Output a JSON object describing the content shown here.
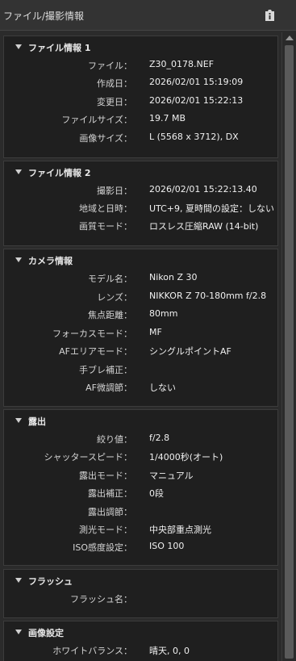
{
  "titlebar": {
    "title": "ファイル/撮影情報",
    "info_icon": "info-icon"
  },
  "sections": [
    {
      "title": "ファイル情報 1",
      "rows": [
        {
          "label": "ファイル：",
          "value": "Z30_0178.NEF"
        },
        {
          "label": "作成日：",
          "value": "2026/02/01 15:19:09"
        },
        {
          "label": "変更日：",
          "value": "2026/02/01 15:22:13"
        },
        {
          "label": "ファイルサイズ：",
          "value": "19.7 MB"
        },
        {
          "label": "画像サイズ：",
          "value": "L (5568 x 3712), DX"
        }
      ]
    },
    {
      "title": "ファイル情報 2",
      "rows": [
        {
          "label": "撮影日：",
          "value": "2026/02/01 15:22:13.40"
        },
        {
          "label": "地域と日時：",
          "value": "UTC+9, 夏時間の設定：しない"
        },
        {
          "label": "画質モード：",
          "value": "ロスレス圧縮RAW (14-bit)"
        }
      ]
    },
    {
      "title": "カメラ情報",
      "rows": [
        {
          "label": "モデル名：",
          "value": "Nikon Z 30"
        },
        {
          "label": "レンズ：",
          "value": "NIKKOR Z 70-180mm f/2.8"
        },
        {
          "label": "焦点距離：",
          "value": "80mm"
        },
        {
          "label": "フォーカスモード：",
          "value": "MF"
        },
        {
          "label": "AFエリアモード：",
          "value": "シングルポイントAF"
        },
        {
          "label": "手ブレ補正：",
          "value": ""
        },
        {
          "label": "AF微調節：",
          "value": "しない"
        }
      ]
    },
    {
      "title": "露出",
      "rows": [
        {
          "label": "絞り値：",
          "value": "f/2.8"
        },
        {
          "label": "シャッタースピード：",
          "value": "1/4000秒(オート)"
        },
        {
          "label": "露出モード：",
          "value": "マニュアル"
        },
        {
          "label": "露出補正：",
          "value": "0段"
        },
        {
          "label": "露出調節：",
          "value": ""
        },
        {
          "label": "測光モード：",
          "value": "中央部重点測光"
        },
        {
          "label": "ISO感度設定：",
          "value": "ISO 100"
        }
      ]
    },
    {
      "title": "フラッシュ",
      "rows": [
        {
          "label": "フラッシュ名：",
          "value": ""
        }
      ]
    },
    {
      "title": "画像設定",
      "rows": [
        {
          "label": "ホワイトバランス：",
          "value": "晴天, 0, 0"
        }
      ]
    }
  ]
}
